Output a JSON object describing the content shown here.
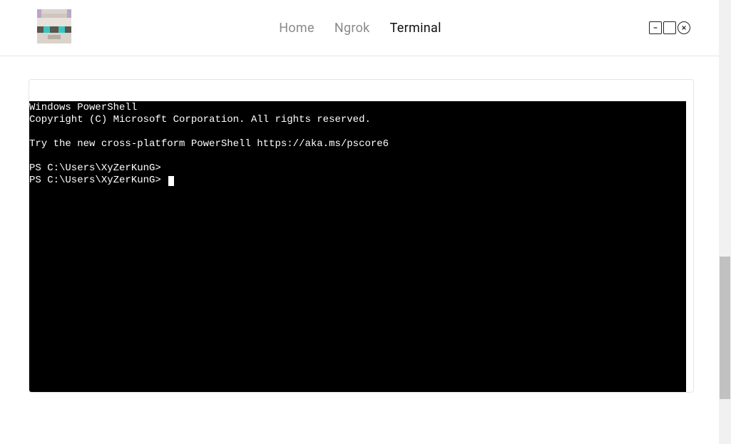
{
  "nav": {
    "items": [
      {
        "label": "Home",
        "active": false
      },
      {
        "label": "Ngrok",
        "active": false
      },
      {
        "label": "Terminal",
        "active": true
      }
    ]
  },
  "terminal": {
    "line1": "Windows PowerShell",
    "line2": "Copyright (C) Microsoft Corporation. All rights reserved.",
    "line3": "",
    "line4": "Try the new cross-platform PowerShell https://aka.ms/pscore6",
    "line5": "",
    "line6": "PS C:\\Users\\XyZerKunG>",
    "line7": "PS C:\\Users\\XyZerKunG> "
  },
  "icons": {
    "minimize": "minimize-icon",
    "maximize": "maximize-icon",
    "close": "close-icon"
  }
}
